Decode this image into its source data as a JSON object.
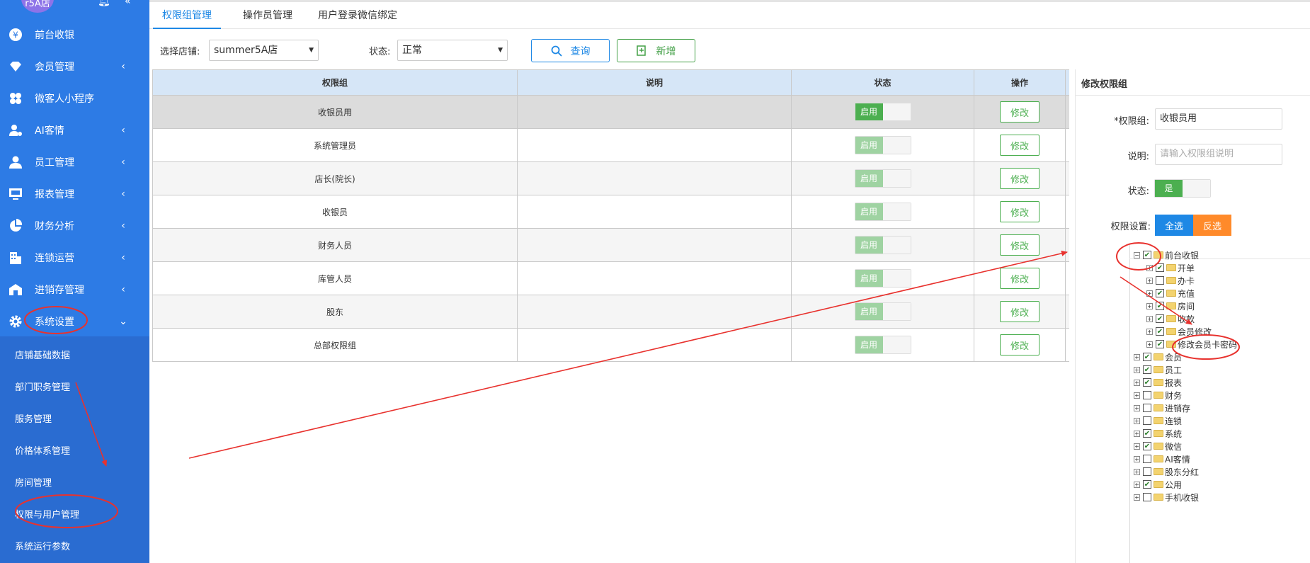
{
  "sidebar": {
    "logo_text": "r5A店",
    "menu": [
      {
        "label": "前台收银",
        "icon": "yen-coin-icon",
        "arrow": ""
      },
      {
        "label": "会员管理",
        "icon": "diamond-icon",
        "arrow": "‹"
      },
      {
        "label": "微客人小程序",
        "icon": "mini-program-icon",
        "arrow": ""
      },
      {
        "label": "AI客情",
        "icon": "user-settings-icon",
        "arrow": "‹"
      },
      {
        "label": "员工管理",
        "icon": "person-icon",
        "arrow": "‹"
      },
      {
        "label": "报表管理",
        "icon": "monitor-icon",
        "arrow": "‹"
      },
      {
        "label": "财务分析",
        "icon": "pie-chart-icon",
        "arrow": "‹"
      },
      {
        "label": "连锁运营",
        "icon": "building-icon",
        "arrow": "‹"
      },
      {
        "label": "进销存管理",
        "icon": "warehouse-icon",
        "arrow": "‹"
      },
      {
        "label": "系统设置",
        "icon": "gear-icon",
        "arrow": "⌄"
      }
    ],
    "submenu": [
      "店铺基础数据",
      "部门职务管理",
      "服务管理",
      "价格体系管理",
      "房间管理",
      "权限与用户管理",
      "系统运行参数"
    ]
  },
  "tabs": [
    "权限组管理",
    "操作员管理",
    "用户登录微信绑定"
  ],
  "filters": {
    "store_label": "选择店铺:",
    "store_value": "summer5A店",
    "status_label": "状态:",
    "status_value": "正常",
    "query_label": "查询",
    "add_label": "新增"
  },
  "table": {
    "headers": [
      "权限组",
      "说明",
      "状态",
      "操作"
    ],
    "toggle_label": "启用",
    "edit_label": "修改",
    "rows": [
      {
        "name": "收银员用",
        "desc": "",
        "enabled": true
      },
      {
        "name": "系统管理员",
        "desc": "",
        "enabled": true
      },
      {
        "name": "店长(院长)",
        "desc": "",
        "enabled": true
      },
      {
        "name": "收银员",
        "desc": "",
        "enabled": true
      },
      {
        "name": "财务人员",
        "desc": "",
        "enabled": true
      },
      {
        "name": "库管人员",
        "desc": "",
        "enabled": true
      },
      {
        "name": "股东",
        "desc": "",
        "enabled": true
      },
      {
        "name": "总部权限组",
        "desc": "",
        "enabled": true
      }
    ]
  },
  "panel": {
    "title": "修改权限组",
    "group_label": "*权限组:",
    "group_value": "收银员用",
    "desc_label": "说明:",
    "desc_placeholder": "请输入权限组说明",
    "status_label": "状态:",
    "status_toggle": "是",
    "perm_label": "权限设置:",
    "select_all": "全选",
    "invert": "反选"
  },
  "tree": [
    {
      "label": "前台收银",
      "level": 0,
      "checked": true,
      "expanded": true
    },
    {
      "label": "开单",
      "level": 1,
      "checked": true
    },
    {
      "label": "办卡",
      "level": 1,
      "checked": false
    },
    {
      "label": "充值",
      "level": 1,
      "checked": true
    },
    {
      "label": "房间",
      "level": 1,
      "checked": true
    },
    {
      "label": "收款",
      "level": 1,
      "checked": true
    },
    {
      "label": "会员修改",
      "level": 1,
      "checked": true
    },
    {
      "label": "修改会员卡密码",
      "level": 1,
      "checked": true
    },
    {
      "label": "会员",
      "level": 0,
      "checked": true
    },
    {
      "label": "员工",
      "level": 0,
      "checked": true
    },
    {
      "label": "报表",
      "level": 0,
      "checked": true
    },
    {
      "label": "财务",
      "level": 0,
      "checked": false
    },
    {
      "label": "进销存",
      "level": 0,
      "checked": false
    },
    {
      "label": "连锁",
      "level": 0,
      "checked": false
    },
    {
      "label": "系统",
      "level": 0,
      "checked": true
    },
    {
      "label": "微信",
      "level": 0,
      "checked": true
    },
    {
      "label": "AI客情",
      "level": 0,
      "checked": false
    },
    {
      "label": "股东分红",
      "level": 0,
      "checked": false
    },
    {
      "label": "公用",
      "level": 0,
      "checked": true
    },
    {
      "label": "手机收银",
      "level": 0,
      "checked": false
    }
  ],
  "colors": {
    "sidebar_bg": "#2d7be5",
    "primary": "#1e88e5",
    "success": "#4caf50",
    "orange": "#ff8a2a",
    "annotation_red": "#e8322e"
  }
}
